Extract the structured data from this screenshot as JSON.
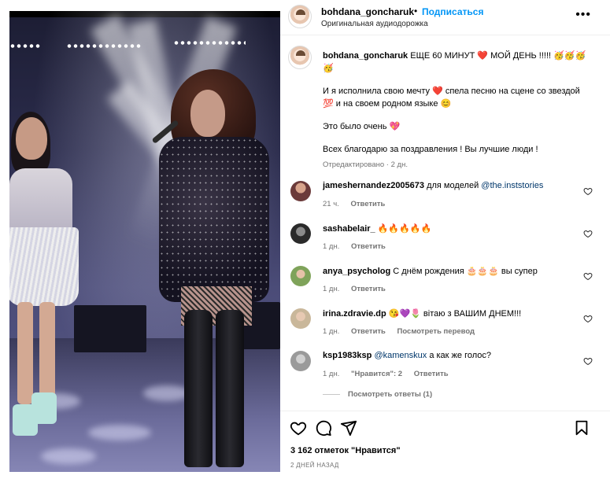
{
  "post": {
    "username": "bohdana_goncharuk",
    "separator": "•",
    "follow_label": "Подписаться",
    "audio_label": "Оригинальная аудиодорожка",
    "more_label": "•••"
  },
  "caption": {
    "username": "bohdana_goncharuk",
    "line1": " ЕЩЕ 60 МИНУТ ❤️ МОЙ ДЕНЬ !!!!! 🥳🥳🥳🥳",
    "para2": "И я исполнила свою мечту ❤️ спела песню на сцене со звездой 💯 и на своем родном языке 😊",
    "para3": "Это было очень 💖",
    "para4": "Всех благодарю за поздравления ! Вы лучшие люди !",
    "meta": "Отредактировано · 2 дн."
  },
  "comments": [
    {
      "user": "jameshernandez2005673",
      "text": " для моделей ",
      "mention": "@the.inststories",
      "time": "21 ч.",
      "reply": "Ответить",
      "avatar_color": "#6b3a3a"
    },
    {
      "user": "sashabelair_",
      "text": " 🔥🔥🔥🔥🔥",
      "mention": "",
      "time": "1 дн.",
      "reply": "Ответить",
      "avatar_color": "#2a2a2a"
    },
    {
      "user": "anya_psycholog",
      "text": " С днём рождения 🎂🎂🎂 вы супер",
      "mention": "",
      "time": "1 дн.",
      "reply": "Ответить",
      "avatar_color": "#7fa35a"
    },
    {
      "user": "irina.zdravie.dp",
      "text": " 😘💜🌷 вітаю з ВАШИМ ДНЕМ!!!",
      "mention": "",
      "time": "1 дн.",
      "reply": "Ответить",
      "extra": "Посмотреть перевод",
      "avatar_color": "#c9b79a"
    },
    {
      "user": "ksp1983ksp",
      "text": " а как же голос?",
      "mention": "@kamenskux",
      "mention_first": true,
      "time": "1 дн.",
      "likes": "\"Нравится\": 2",
      "reply": "Ответить",
      "avatar_color": "#9a9a9a"
    }
  ],
  "view_replies": "Посмотреть ответы (1)",
  "likes": "3 162 отметок \"Нравится\"",
  "date": "2 ДНЕЙ НАЗАД",
  "colors": {
    "link": "#0095f6",
    "mention": "#00376b",
    "muted": "#737373"
  },
  "icons": [
    "heart-icon",
    "comment-icon",
    "share-icon",
    "bookmark-icon",
    "more-icon"
  ]
}
